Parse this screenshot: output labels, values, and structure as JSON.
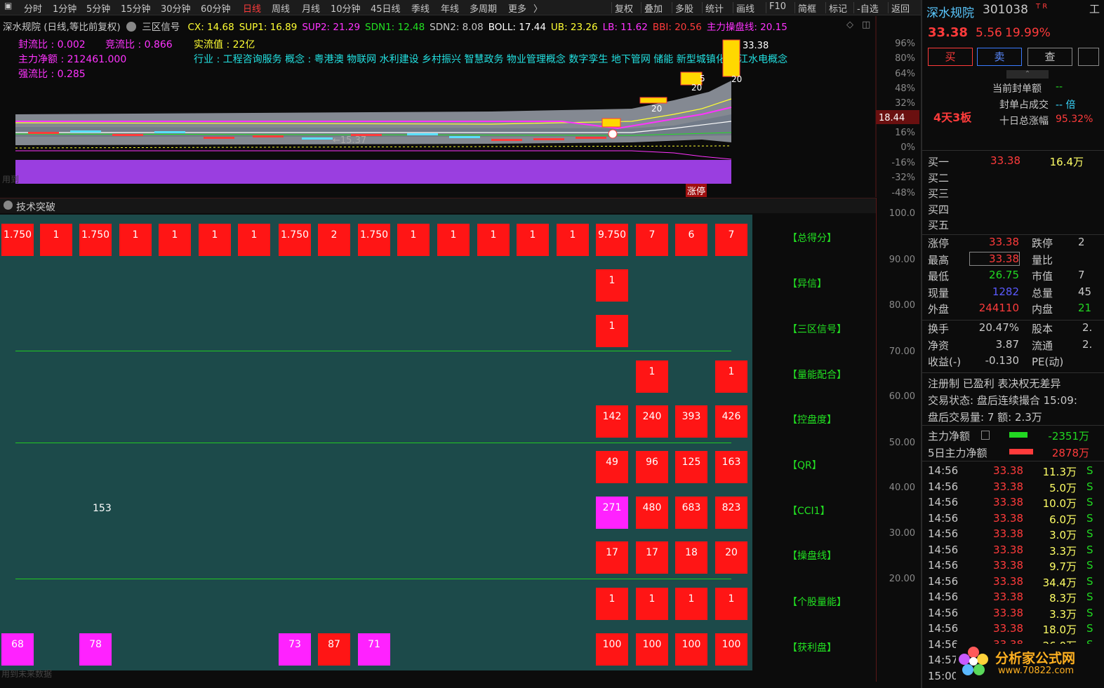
{
  "toolbar": {
    "left_tabs": [
      "分时",
      "1分钟",
      "5分钟",
      "15分钟",
      "30分钟",
      "60分钟",
      "日线",
      "周线",
      "月线",
      "10分钟",
      "45日线",
      "季线",
      "年线",
      "多周期",
      "更多"
    ],
    "active_tab": "日线",
    "right_tabs": [
      "复权",
      "叠加",
      "多股",
      "统计",
      "画线",
      "F10",
      "简框",
      "标记",
      "-自选",
      "返回"
    ]
  },
  "header": {
    "stock_title": "深水规院 (日线,等比前复权)",
    "formula_name": "三区信号",
    "indicators": [
      {
        "label": "CX: 14.68",
        "color": "#ffff33"
      },
      {
        "label": "SUP1: 16.89",
        "color": "#ffff33"
      },
      {
        "label": "SUP2: 21.29",
        "color": "#ff33ff"
      },
      {
        "label": "SDN1: 12.48",
        "color": "#22e022"
      },
      {
        "label": "SDN2: 8.08",
        "color": "#c8c8c8"
      },
      {
        "label": "BOLL: 17.44",
        "color": "#ffffff"
      },
      {
        "label": "UB: 23.26",
        "color": "#ffff33"
      },
      {
        "label": "LB: 11.62",
        "color": "#ff33ff"
      },
      {
        "label": "BBI: 20.56",
        "color": "#ff3b3b"
      },
      {
        "label": "主力操盘线: 20.15",
        "color": "#ff33ff"
      }
    ]
  },
  "stats": {
    "fengliu": "封流比 : 0.002",
    "jingliu": "竞流比 : 0.866",
    "shiliu": "实流值 : 22亿",
    "zhuli": "主力净额 : 212461.000",
    "qiangliu": "强流比 : 0.285",
    "industry": "行业 : 工程咨询服务  概念 : 粤港澳  物联网  水利建设  乡村振兴  智慧政务  物业管理概念  数字孪生  地下管网  储能  新型城镇化  雅江水电概念"
  },
  "upper_chart": {
    "y_ticks": [
      "96%",
      "80%",
      "64%",
      "48%",
      "32%",
      "16%",
      "0%",
      "-16%",
      "-32%",
      "-48%"
    ],
    "price_marker": "18.44",
    "high_label": "33.38",
    "low_label": "←15.37",
    "candle_labels": [
      "20",
      "20",
      "5",
      "20"
    ],
    "bottom_label": "涨停",
    "left_label": "用到"
  },
  "lower_panel": {
    "title": "技术突破",
    "y_ticks": [
      "100.0",
      "90.00",
      "80.00",
      "70.00",
      "60.00",
      "50.00",
      "40.00",
      "30.00",
      "20.00"
    ],
    "footer": "用到未来数据",
    "row_labels": [
      "【总得分】",
      "【异信】",
      "【三区信号】",
      "【量能配合】",
      "【控盘度】",
      "【QR】",
      "【CCI1】",
      "【操盘线】",
      "【个股量能】",
      "【获利盘】"
    ],
    "columns": [
      "c0",
      "c1",
      "c2",
      "c3",
      "c4",
      "c5",
      "c6",
      "c7",
      "c8",
      "c9",
      "c10",
      "c11",
      "c12",
      "c13",
      "c14",
      "c15",
      "c16",
      "c17",
      "c18"
    ],
    "rows": [
      [
        "1.750",
        "1",
        "1.750",
        "1",
        "1",
        "1",
        "1",
        "1.750",
        "2",
        "1.750",
        "1",
        "1",
        "1",
        "1",
        "1",
        "9.750",
        "7",
        "6",
        "7"
      ],
      [
        null,
        null,
        null,
        null,
        null,
        null,
        null,
        null,
        null,
        null,
        null,
        null,
        null,
        null,
        null,
        "1",
        null,
        null,
        null
      ],
      [
        null,
        null,
        null,
        null,
        null,
        null,
        null,
        null,
        null,
        null,
        null,
        null,
        null,
        null,
        null,
        "1",
        null,
        null,
        null
      ],
      [
        null,
        null,
        null,
        null,
        null,
        null,
        null,
        null,
        null,
        null,
        null,
        null,
        null,
        null,
        null,
        null,
        "1",
        null,
        "1"
      ],
      [
        null,
        null,
        null,
        null,
        null,
        null,
        null,
        null,
        null,
        null,
        null,
        null,
        null,
        null,
        null,
        "142",
        "240",
        "393",
        "426"
      ],
      [
        null,
        null,
        null,
        null,
        null,
        null,
        null,
        null,
        null,
        null,
        null,
        null,
        null,
        null,
        null,
        "49",
        "96",
        "125",
        "163"
      ],
      [
        null,
        null,
        null,
        null,
        null,
        null,
        null,
        null,
        null,
        null,
        null,
        null,
        null,
        null,
        null,
        "271",
        "480",
        "683",
        "823"
      ],
      [
        null,
        null,
        null,
        null,
        null,
        null,
        null,
        null,
        null,
        null,
        null,
        null,
        null,
        null,
        null,
        "17",
        "17",
        "18",
        "20"
      ],
      [
        null,
        null,
        null,
        null,
        null,
        null,
        null,
        null,
        null,
        null,
        null,
        null,
        null,
        null,
        null,
        "1",
        "1",
        "1",
        "1"
      ],
      [
        "68",
        null,
        "78",
        null,
        null,
        null,
        null,
        "73",
        "87",
        "71",
        null,
        null,
        null,
        null,
        null,
        "100",
        "100",
        "100",
        "100"
      ]
    ],
    "magenta_cells": [
      "6-15",
      "9-0",
      "9-2",
      "9-7",
      "9-9"
    ],
    "floating_value": "153"
  },
  "right_panel": {
    "name": "深水规院",
    "code": "301038",
    "code_marks": "T R",
    "price": "33.38",
    "change": "5.56",
    "change_pct": "19.99%",
    "buy_btn": "买",
    "sell_btn": "卖",
    "query_btn": "查",
    "board_tag": "4天3板",
    "seal_labels": [
      "当前封单额",
      "封单占成交",
      "十日总涨幅"
    ],
    "seal_values": [
      "--",
      "-- 倍",
      "95.32%"
    ],
    "orderbook": [
      {
        "label": "买一",
        "price": "33.38",
        "vol": "16.4万"
      },
      {
        "label": "买二",
        "price": "",
        "vol": ""
      },
      {
        "label": "买三",
        "price": "",
        "vol": ""
      },
      {
        "label": "买四",
        "price": "",
        "vol": ""
      },
      {
        "label": "买五",
        "price": "",
        "vol": ""
      }
    ],
    "quote": [
      {
        "l1": "涨停",
        "v1": "33.38",
        "l2": "跌停",
        "v2": "2"
      },
      {
        "l1": "最高",
        "v1": "33.38",
        "l2": "量比",
        "v2": ""
      },
      {
        "l1": "最低",
        "v1": "26.75",
        "l2": "市值",
        "v2": "7"
      },
      {
        "l1": "现量",
        "v1": "1282",
        "l2": "总量",
        "v2": "45"
      },
      {
        "l1": "外盘",
        "v1": "244110",
        "l2": "内盘",
        "v2": "21"
      }
    ],
    "fund": [
      {
        "l1": "换手",
        "v1": "20.47%",
        "l2": "股本",
        "v2": "2."
      },
      {
        "l1": "净资",
        "v1": "3.87",
        "l2": "流通",
        "v2": "2."
      },
      {
        "l1": "收益(-)",
        "v1": "-0.130",
        "l2": "PE(动)",
        "v2": ""
      }
    ],
    "reg_line": "注册制 已盈利 表决权无差异",
    "trade_status": "交易状态: 盘后连续撮合 15:09:",
    "after_trade": "盘后交易量: 7  额: 2.3万",
    "main_net_label": "主力净额",
    "main_net_value": "-2351万",
    "main_net_5_label": "5日主力净额",
    "main_net_5_value": "2878万",
    "ticks": [
      {
        "t": "14:56",
        "p": "33.38",
        "v": "11.3万",
        "s": "S"
      },
      {
        "t": "14:56",
        "p": "33.38",
        "v": "5.0万",
        "s": "S"
      },
      {
        "t": "14:56",
        "p": "33.38",
        "v": "10.0万",
        "s": "S"
      },
      {
        "t": "14:56",
        "p": "33.38",
        "v": "6.0万",
        "s": "S"
      },
      {
        "t": "14:56",
        "p": "33.38",
        "v": "3.0万",
        "s": "S"
      },
      {
        "t": "14:56",
        "p": "33.38",
        "v": "3.3万",
        "s": "S"
      },
      {
        "t": "14:56",
        "p": "33.38",
        "v": "9.7万",
        "s": "S"
      },
      {
        "t": "14:56",
        "p": "33.38",
        "v": "34.4万",
        "s": "S"
      },
      {
        "t": "14:56",
        "p": "33.38",
        "v": "8.3万",
        "s": "S"
      },
      {
        "t": "14:56",
        "p": "33.38",
        "v": "3.3万",
        "s": "S"
      },
      {
        "t": "14:56",
        "p": "33.38",
        "v": "18.0万",
        "s": "S"
      },
      {
        "t": "14:56",
        "p": "33.38",
        "v": "26.0万",
        "s": "S"
      },
      {
        "t": "14:57",
        "p": "",
        "v": "",
        "s": ""
      },
      {
        "t": "15:00",
        "p": "",
        "v": "",
        "s": ""
      }
    ],
    "watermark": "分析家公式网",
    "watermark_url": "www.70822.com",
    "side_tab": "工"
  },
  "colors": {
    "up": "#ff3b3b",
    "down": "#22d822",
    "grid_bg": "#1c4a4a",
    "cell_red": "#ff1515",
    "cell_magenta": "#ff22ff",
    "volume_purple": "#9a3ee0"
  }
}
